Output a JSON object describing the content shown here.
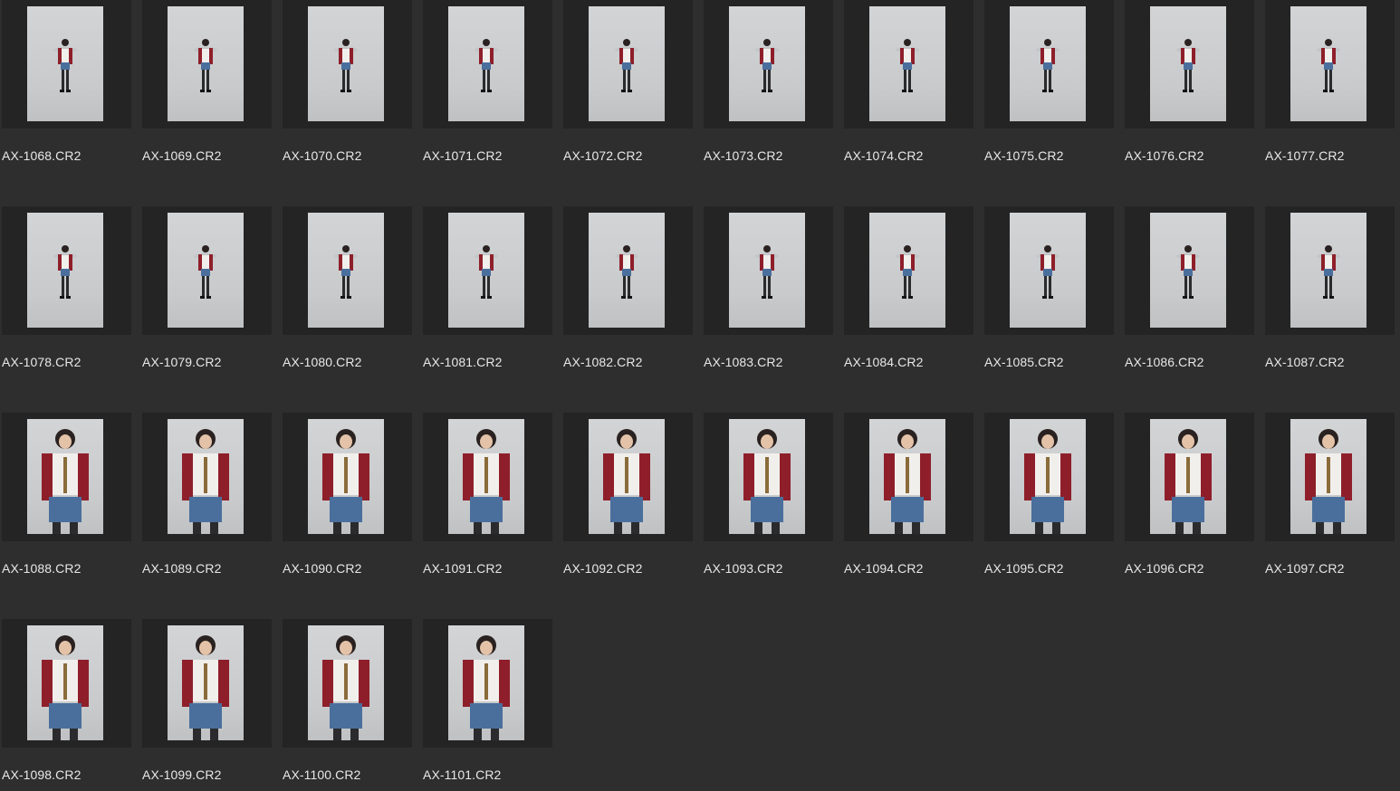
{
  "colors": {
    "background": "#2e2e2e",
    "frame": "#242424",
    "text": "#e8e8e8",
    "backdrop": "#cfd1d3",
    "shirt_red": "#8e1f2a",
    "denim": "#4a6f9c"
  },
  "files": [
    {
      "name": "AX-1068.CR2",
      "shot": "full"
    },
    {
      "name": "AX-1069.CR2",
      "shot": "full"
    },
    {
      "name": "AX-1070.CR2",
      "shot": "full"
    },
    {
      "name": "AX-1071.CR2",
      "shot": "full"
    },
    {
      "name": "AX-1072.CR2",
      "shot": "full"
    },
    {
      "name": "AX-1073.CR2",
      "shot": "full"
    },
    {
      "name": "AX-1074.CR2",
      "shot": "full"
    },
    {
      "name": "AX-1075.CR2",
      "shot": "full"
    },
    {
      "name": "AX-1076.CR2",
      "shot": "full"
    },
    {
      "name": "AX-1077.CR2",
      "shot": "full"
    },
    {
      "name": "AX-1078.CR2",
      "shot": "full"
    },
    {
      "name": "AX-1079.CR2",
      "shot": "full"
    },
    {
      "name": "AX-1080.CR2",
      "shot": "full"
    },
    {
      "name": "AX-1081.CR2",
      "shot": "full"
    },
    {
      "name": "AX-1082.CR2",
      "shot": "full"
    },
    {
      "name": "AX-1083.CR2",
      "shot": "full"
    },
    {
      "name": "AX-1084.CR2",
      "shot": "full"
    },
    {
      "name": "AX-1085.CR2",
      "shot": "full"
    },
    {
      "name": "AX-1086.CR2",
      "shot": "full"
    },
    {
      "name": "AX-1087.CR2",
      "shot": "full"
    },
    {
      "name": "AX-1088.CR2",
      "shot": "half"
    },
    {
      "name": "AX-1089.CR2",
      "shot": "half"
    },
    {
      "name": "AX-1090.CR2",
      "shot": "half"
    },
    {
      "name": "AX-1091.CR2",
      "shot": "half"
    },
    {
      "name": "AX-1092.CR2",
      "shot": "half"
    },
    {
      "name": "AX-1093.CR2",
      "shot": "half"
    },
    {
      "name": "AX-1094.CR2",
      "shot": "half"
    },
    {
      "name": "AX-1095.CR2",
      "shot": "half"
    },
    {
      "name": "AX-1096.CR2",
      "shot": "half"
    },
    {
      "name": "AX-1097.CR2",
      "shot": "half"
    },
    {
      "name": "AX-1098.CR2",
      "shot": "half"
    },
    {
      "name": "AX-1099.CR2",
      "shot": "half"
    },
    {
      "name": "AX-1100.CR2",
      "shot": "half"
    },
    {
      "name": "AX-1101.CR2",
      "shot": "half"
    }
  ]
}
